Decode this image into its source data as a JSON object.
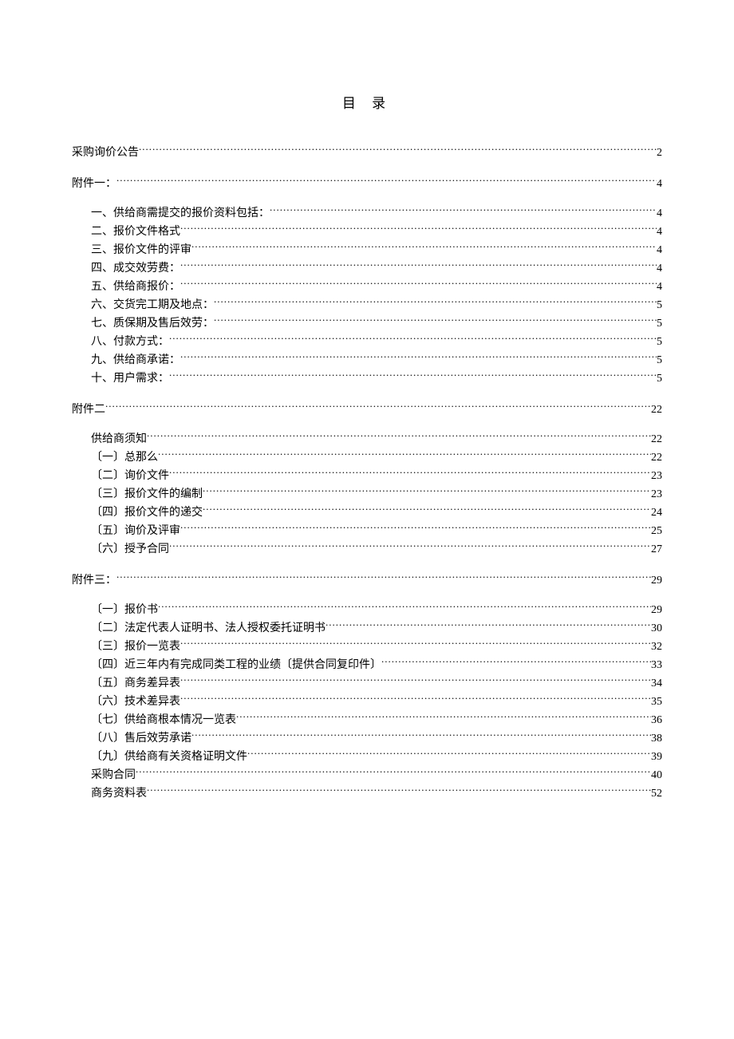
{
  "title": "目  录",
  "entries": [
    {
      "label": "采购询价公告",
      "page": "2",
      "level": 0,
      "gap": ""
    },
    {
      "label": "附件一：",
      "page": "4",
      "level": 0,
      "gap": "section-gap"
    },
    {
      "label": "一、供给商需提交的报价资料包括：",
      "page": "4",
      "level": 1,
      "gap": "subsection-start"
    },
    {
      "label": "二、报价文件格式",
      "page": "4",
      "level": 1,
      "gap": ""
    },
    {
      "label": "三、报价文件的评审",
      "page": "4",
      "level": 1,
      "gap": ""
    },
    {
      "label": "四、成交效劳费：",
      "page": "4",
      "level": 1,
      "gap": ""
    },
    {
      "label": "五、供给商报价：",
      "page": "4",
      "level": 1,
      "gap": ""
    },
    {
      "label": "六、交货完工期及地点：",
      "page": "5",
      "level": 1,
      "gap": ""
    },
    {
      "label": "七、质保期及售后效劳：",
      "page": "5",
      "level": 1,
      "gap": ""
    },
    {
      "label": "八、付款方式：",
      "page": "5",
      "level": 1,
      "gap": ""
    },
    {
      "label": "九、供给商承诺：",
      "page": "5",
      "level": 1,
      "gap": ""
    },
    {
      "label": "十、用户需求：",
      "page": "5",
      "level": 1,
      "gap": ""
    },
    {
      "label": "附件二",
      "page": "22",
      "level": 0,
      "gap": "section-gap"
    },
    {
      "label": "供给商须知",
      "page": "22",
      "level": 1,
      "gap": "subsection-start"
    },
    {
      "label": "〔一〕总那么",
      "page": "22",
      "level": 1,
      "gap": ""
    },
    {
      "label": "〔二〕询价文件",
      "page": "23",
      "level": 1,
      "gap": ""
    },
    {
      "label": "〔三〕报价文件的编制",
      "page": "23",
      "level": 1,
      "gap": ""
    },
    {
      "label": "〔四〕报价文件的递交",
      "page": "24",
      "level": 1,
      "gap": ""
    },
    {
      "label": "〔五〕询价及评审",
      "page": "25",
      "level": 1,
      "gap": ""
    },
    {
      "label": "〔六〕授予合同",
      "page": "27",
      "level": 1,
      "gap": ""
    },
    {
      "label": "附件三：",
      "page": "29",
      "level": 0,
      "gap": "section-gap"
    },
    {
      "label": "〔一〕报价书",
      "page": "29",
      "level": 1,
      "gap": "subsection-start"
    },
    {
      "label": "〔二〕法定代表人证明书、法人授权委托证明书",
      "page": "30",
      "level": 1,
      "gap": ""
    },
    {
      "label": "〔三〕报价一览表",
      "page": "32",
      "level": 1,
      "gap": ""
    },
    {
      "label": "〔四〕近三年内有完成同类工程的业绩〔提供合同复印件〕",
      "page": "33",
      "level": 1,
      "gap": ""
    },
    {
      "label": "〔五〕商务差异表",
      "page": "34",
      "level": 1,
      "gap": ""
    },
    {
      "label": "〔六〕技术差异表",
      "page": "35",
      "level": 1,
      "gap": ""
    },
    {
      "label": "〔七〕供给商根本情况一览表",
      "page": "36",
      "level": 1,
      "gap": ""
    },
    {
      "label": "〔八〕售后效劳承诺",
      "page": "38",
      "level": 1,
      "gap": ""
    },
    {
      "label": "〔九〕供给商有关资格证明文件",
      "page": "39",
      "level": 1,
      "gap": ""
    },
    {
      "label": "采购合同",
      "page": "40",
      "level": 1,
      "gap": ""
    },
    {
      "label": "商务资料表",
      "page": "52",
      "level": 1,
      "gap": ""
    }
  ]
}
